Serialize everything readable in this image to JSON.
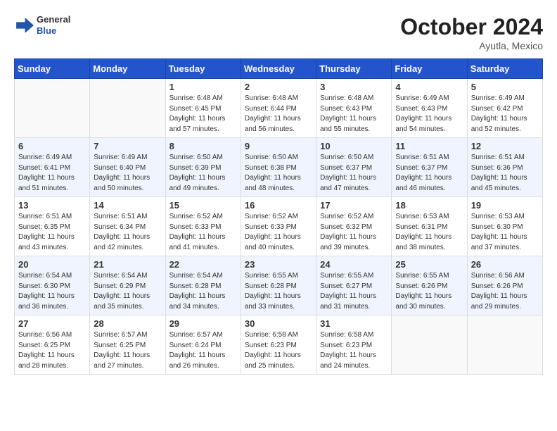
{
  "header": {
    "logo_line1": "General",
    "logo_line2": "Blue",
    "month_title": "October 2024",
    "subtitle": "Ayutla, Mexico"
  },
  "weekdays": [
    "Sunday",
    "Monday",
    "Tuesday",
    "Wednesday",
    "Thursday",
    "Friday",
    "Saturday"
  ],
  "weeks": [
    [
      {
        "day": "",
        "info": ""
      },
      {
        "day": "",
        "info": ""
      },
      {
        "day": "1",
        "info": "Sunrise: 6:48 AM\nSunset: 6:45 PM\nDaylight: 11 hours and 57 minutes."
      },
      {
        "day": "2",
        "info": "Sunrise: 6:48 AM\nSunset: 6:44 PM\nDaylight: 11 hours and 56 minutes."
      },
      {
        "day": "3",
        "info": "Sunrise: 6:48 AM\nSunset: 6:43 PM\nDaylight: 11 hours and 55 minutes."
      },
      {
        "day": "4",
        "info": "Sunrise: 6:49 AM\nSunset: 6:43 PM\nDaylight: 11 hours and 54 minutes."
      },
      {
        "day": "5",
        "info": "Sunrise: 6:49 AM\nSunset: 6:42 PM\nDaylight: 11 hours and 52 minutes."
      }
    ],
    [
      {
        "day": "6",
        "info": "Sunrise: 6:49 AM\nSunset: 6:41 PM\nDaylight: 11 hours and 51 minutes."
      },
      {
        "day": "7",
        "info": "Sunrise: 6:49 AM\nSunset: 6:40 PM\nDaylight: 11 hours and 50 minutes."
      },
      {
        "day": "8",
        "info": "Sunrise: 6:50 AM\nSunset: 6:39 PM\nDaylight: 11 hours and 49 minutes."
      },
      {
        "day": "9",
        "info": "Sunrise: 6:50 AM\nSunset: 6:38 PM\nDaylight: 11 hours and 48 minutes."
      },
      {
        "day": "10",
        "info": "Sunrise: 6:50 AM\nSunset: 6:37 PM\nDaylight: 11 hours and 47 minutes."
      },
      {
        "day": "11",
        "info": "Sunrise: 6:51 AM\nSunset: 6:37 PM\nDaylight: 11 hours and 46 minutes."
      },
      {
        "day": "12",
        "info": "Sunrise: 6:51 AM\nSunset: 6:36 PM\nDaylight: 11 hours and 45 minutes."
      }
    ],
    [
      {
        "day": "13",
        "info": "Sunrise: 6:51 AM\nSunset: 6:35 PM\nDaylight: 11 hours and 43 minutes."
      },
      {
        "day": "14",
        "info": "Sunrise: 6:51 AM\nSunset: 6:34 PM\nDaylight: 11 hours and 42 minutes."
      },
      {
        "day": "15",
        "info": "Sunrise: 6:52 AM\nSunset: 6:33 PM\nDaylight: 11 hours and 41 minutes."
      },
      {
        "day": "16",
        "info": "Sunrise: 6:52 AM\nSunset: 6:33 PM\nDaylight: 11 hours and 40 minutes."
      },
      {
        "day": "17",
        "info": "Sunrise: 6:52 AM\nSunset: 6:32 PM\nDaylight: 11 hours and 39 minutes."
      },
      {
        "day": "18",
        "info": "Sunrise: 6:53 AM\nSunset: 6:31 PM\nDaylight: 11 hours and 38 minutes."
      },
      {
        "day": "19",
        "info": "Sunrise: 6:53 AM\nSunset: 6:30 PM\nDaylight: 11 hours and 37 minutes."
      }
    ],
    [
      {
        "day": "20",
        "info": "Sunrise: 6:54 AM\nSunset: 6:30 PM\nDaylight: 11 hours and 36 minutes."
      },
      {
        "day": "21",
        "info": "Sunrise: 6:54 AM\nSunset: 6:29 PM\nDaylight: 11 hours and 35 minutes."
      },
      {
        "day": "22",
        "info": "Sunrise: 6:54 AM\nSunset: 6:28 PM\nDaylight: 11 hours and 34 minutes."
      },
      {
        "day": "23",
        "info": "Sunrise: 6:55 AM\nSunset: 6:28 PM\nDaylight: 11 hours and 33 minutes."
      },
      {
        "day": "24",
        "info": "Sunrise: 6:55 AM\nSunset: 6:27 PM\nDaylight: 11 hours and 31 minutes."
      },
      {
        "day": "25",
        "info": "Sunrise: 6:55 AM\nSunset: 6:26 PM\nDaylight: 11 hours and 30 minutes."
      },
      {
        "day": "26",
        "info": "Sunrise: 6:56 AM\nSunset: 6:26 PM\nDaylight: 11 hours and 29 minutes."
      }
    ],
    [
      {
        "day": "27",
        "info": "Sunrise: 6:56 AM\nSunset: 6:25 PM\nDaylight: 11 hours and 28 minutes."
      },
      {
        "day": "28",
        "info": "Sunrise: 6:57 AM\nSunset: 6:25 PM\nDaylight: 11 hours and 27 minutes."
      },
      {
        "day": "29",
        "info": "Sunrise: 6:57 AM\nSunset: 6:24 PM\nDaylight: 11 hours and 26 minutes."
      },
      {
        "day": "30",
        "info": "Sunrise: 6:58 AM\nSunset: 6:23 PM\nDaylight: 11 hours and 25 minutes."
      },
      {
        "day": "31",
        "info": "Sunrise: 6:58 AM\nSunset: 6:23 PM\nDaylight: 11 hours and 24 minutes."
      },
      {
        "day": "",
        "info": ""
      },
      {
        "day": "",
        "info": ""
      }
    ]
  ]
}
